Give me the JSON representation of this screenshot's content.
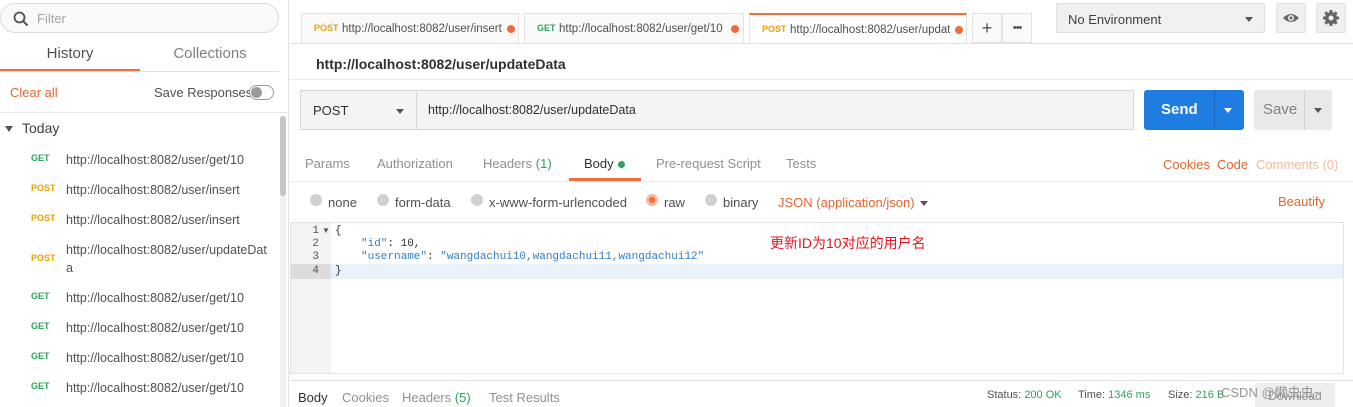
{
  "sidebar": {
    "filter_placeholder": "Filter",
    "tabs": [
      "History",
      "Collections"
    ],
    "clear_all": "Clear all",
    "save_responses": "Save Responses",
    "group": "Today",
    "history": [
      {
        "method": "GET",
        "url": "http://localhost:8082/user/get/10"
      },
      {
        "method": "POST",
        "url": "http://localhost:8082/user/insert"
      },
      {
        "method": "POST",
        "url": "http://localhost:8082/user/insert"
      },
      {
        "method": "POST",
        "url": "http://localhost:8082/user/updateData"
      },
      {
        "method": "GET",
        "url": "http://localhost:8082/user/get/10"
      },
      {
        "method": "GET",
        "url": "http://localhost:8082/user/get/10"
      },
      {
        "method": "GET",
        "url": "http://localhost:8082/user/get/10"
      },
      {
        "method": "GET",
        "url": "http://localhost:8082/user/get/10"
      }
    ]
  },
  "tabs": [
    {
      "method": "POST",
      "url": "http://localhost:8082/user/insert"
    },
    {
      "method": "GET",
      "url": "http://localhost:8082/user/get/10"
    },
    {
      "method": "POST",
      "url": "http://localhost:8082/user/updateData"
    }
  ],
  "toolbar": {
    "add_tab": "+",
    "more_tabs": "•••",
    "environment": "No Environment"
  },
  "request": {
    "name": "http://localhost:8082/user/updateData",
    "method": "POST",
    "url": "http://localhost:8082/user/updateData",
    "send": "Send",
    "save": "Save"
  },
  "subtabs": {
    "params": "Params",
    "authorization": "Authorization",
    "headers": "Headers",
    "headers_count": "(1)",
    "body": "Body",
    "prerequest": "Pre-request Script",
    "tests": "Tests",
    "cookies": "Cookies",
    "code": "Code",
    "comments": "Comments (0)"
  },
  "body_options": {
    "none": "none",
    "form_data": "form-data",
    "urlencoded": "x-www-form-urlencoded",
    "raw": "raw",
    "binary": "binary",
    "content_type": "JSON (application/json)",
    "beautify": "Beautify"
  },
  "editor": {
    "line_numbers": [
      "1",
      "2",
      "3",
      "4"
    ],
    "line1": "{",
    "id_key": "\"id\"",
    "id_value": "10,",
    "username_key": "\"username\"",
    "username_value": "\"wangdachui10,wangdachui11,wangdachui12\"",
    "line4": "}",
    "annotation": "更新ID为10对应的用户名"
  },
  "response": {
    "tabs": {
      "body": "Body",
      "cookies": "Cookies",
      "headers": "Headers",
      "headers_count": "(5)",
      "test_results": "Test Results"
    },
    "status_label": "Status:",
    "status_value": "200 OK",
    "time_label": "Time:",
    "time_value": "1346 ms",
    "size_label": "Size:",
    "size_value": "216 B",
    "download": "Download",
    "watermark": "CSDN @懒虫虫~"
  },
  "colors": {
    "accent": "#f26b3a",
    "send": "#1f7ce0",
    "get": "#2aa55e",
    "post": "#f0a000",
    "annotation": "#e8141e"
  }
}
